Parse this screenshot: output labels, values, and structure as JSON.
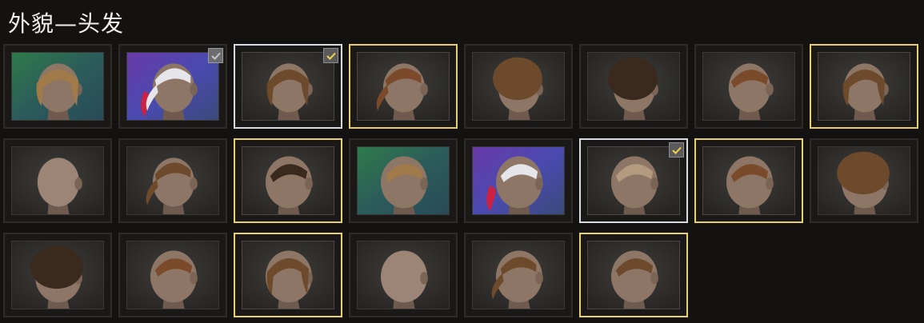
{
  "header": {
    "title": "外貌—头发"
  },
  "colors": {
    "outline_gold": "#e8cf6a",
    "outline_selected": "#d9dbe2",
    "tile_border": "#2e2c28",
    "check_active": "#f1d54a",
    "check_owned": "#c8c8c8"
  },
  "hair_items": [
    {
      "head": "female",
      "hair": "short-bob-blond",
      "bg": "green-teal",
      "outline": "none",
      "check": "none"
    },
    {
      "head": "female",
      "hair": "white-ponytail-red-tips",
      "bg": "purple-blue",
      "outline": "none",
      "check": "owned"
    },
    {
      "head": "female",
      "hair": "bob-brown",
      "bg": "dark",
      "outline": "selected",
      "check": "active"
    },
    {
      "head": "female",
      "hair": "low-ponytail-auburn",
      "bg": "dark",
      "outline": "gold",
      "check": "none"
    },
    {
      "head": "female",
      "hair": "curly-afro-brown",
      "bg": "dark",
      "outline": "none",
      "check": "none"
    },
    {
      "head": "female",
      "hair": "curly-dark",
      "bg": "dark",
      "outline": "none",
      "check": "none"
    },
    {
      "head": "female",
      "hair": "undercut-auburn",
      "bg": "dark",
      "outline": "none",
      "check": "none"
    },
    {
      "head": "female",
      "hair": "wavy-bob-brown",
      "bg": "dark",
      "outline": "gold",
      "check": "none"
    },
    {
      "head": "female",
      "hair": "shaved-bald",
      "bg": "dark",
      "outline": "none",
      "check": "none"
    },
    {
      "head": "female",
      "hair": "ponytail-brown",
      "bg": "dark",
      "outline": "none",
      "check": "none"
    },
    {
      "head": "male",
      "hair": "long-fringe-dark",
      "bg": "dark",
      "outline": "gold",
      "check": "none"
    },
    {
      "head": "male",
      "hair": "bowl-cut-blond",
      "bg": "green-teal",
      "outline": "none",
      "check": "none"
    },
    {
      "head": "male",
      "hair": "white-slick-red-tips",
      "bg": "purple-blue",
      "outline": "none",
      "check": "none"
    },
    {
      "head": "male",
      "hair": "buzz-light",
      "bg": "dark",
      "outline": "selected",
      "check": "active"
    },
    {
      "head": "male",
      "hair": "side-part-auburn",
      "bg": "dark",
      "outline": "gold",
      "check": "none"
    },
    {
      "head": "male",
      "hair": "curly-afro-brown",
      "bg": "dark",
      "outline": "none",
      "check": "none"
    },
    {
      "head": "male",
      "hair": "curly-short-dark",
      "bg": "dark",
      "outline": "none",
      "check": "none"
    },
    {
      "head": "male",
      "hair": "undercut-auburn",
      "bg": "dark",
      "outline": "none",
      "check": "none"
    },
    {
      "head": "male",
      "hair": "wavy-medium-brown",
      "bg": "dark",
      "outline": "gold",
      "check": "none"
    },
    {
      "head": "male",
      "hair": "bald",
      "bg": "dark",
      "outline": "none",
      "check": "none"
    },
    {
      "head": "male",
      "hair": "man-bun-brown",
      "bg": "dark",
      "outline": "none",
      "check": "none"
    },
    {
      "head": "male",
      "hair": "slicked-back-brown",
      "bg": "dark",
      "outline": "gold",
      "check": "none"
    }
  ]
}
